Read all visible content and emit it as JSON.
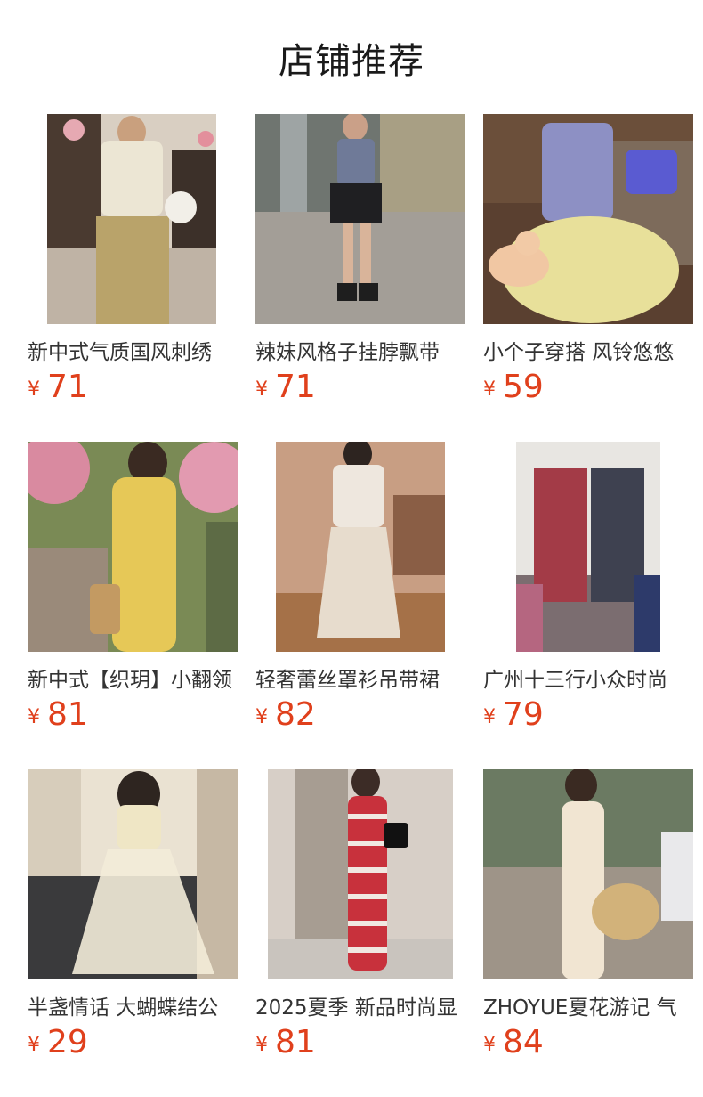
{
  "section": {
    "title": "店铺推荐"
  },
  "products": [
    {
      "title": "新中式气质国风刺绣",
      "currency": "¥",
      "price": "71"
    },
    {
      "title": "辣妹风格子挂脖飘带",
      "currency": "¥",
      "price": "71"
    },
    {
      "title": "小个子穿搭 风铃悠悠",
      "currency": "¥",
      "price": "59"
    },
    {
      "title": "新中式【织玥】小翻领",
      "currency": "¥",
      "price": "81"
    },
    {
      "title": "轻奢蕾丝罩衫吊带裙",
      "currency": "¥",
      "price": "82"
    },
    {
      "title": "广州十三行小众时尚",
      "currency": "¥",
      "price": "79"
    },
    {
      "title": "半盏情话 大蝴蝶结公",
      "currency": "¥",
      "price": "29"
    },
    {
      "title": "2025夏季 新品时尚显",
      "currency": "¥",
      "price": "81"
    },
    {
      "title": "ZHOYUE夏花游记 气",
      "currency": "¥",
      "price": "84"
    }
  ],
  "colors": {
    "price": "#e0401c",
    "title": "#1a1a1a",
    "text": "#333333"
  }
}
